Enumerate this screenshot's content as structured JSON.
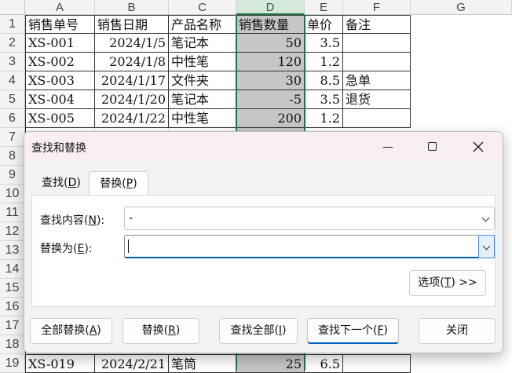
{
  "sheet": {
    "columns": [
      "A",
      "B",
      "C",
      "D",
      "E",
      "F",
      "G"
    ],
    "rows": [
      "1",
      "2",
      "3",
      "4",
      "5",
      "6",
      "7",
      "8",
      "9",
      "10",
      "11",
      "12",
      "13",
      "14",
      "15",
      "16",
      "17",
      "18",
      "19"
    ],
    "headers": [
      "销售单号",
      "销售日期",
      "产品名称",
      "销售数量",
      "单价",
      "备注"
    ],
    "data": [
      [
        "XS-001",
        "2024/1/5",
        "笔记本",
        "50",
        "3.5",
        ""
      ],
      [
        "XS-002",
        "2024/1/8",
        "中性笔",
        "120",
        "1.2",
        ""
      ],
      [
        "XS-003",
        "2024/1/17",
        "文件夹",
        "30",
        "8.5",
        "急单"
      ],
      [
        "XS-004",
        "2024/1/20",
        "笔记本",
        "-5",
        "3.5",
        "退货"
      ],
      [
        "XS-005",
        "2024/1/22",
        "中性笔",
        "200",
        "1.2",
        ""
      ]
    ],
    "last_row": [
      "XS-019",
      "2024/2/21",
      "笔筒",
      "25",
      "6.5",
      ""
    ]
  },
  "dialog": {
    "title": "查找和替换",
    "tabs": [
      {
        "label_main": "查找(",
        "key": "D",
        "label_end": ")"
      },
      {
        "label_main": "替换(",
        "key": "P",
        "label_end": ")"
      }
    ],
    "find_label": {
      "main": "查找内容(",
      "key": "N",
      "end": "):"
    },
    "find_value": "-",
    "replace_label": {
      "main": "替换为(",
      "key": "E",
      "end": "):"
    },
    "replace_value": "",
    "options_button": {
      "main": "选项(",
      "key": "T",
      "end": ") >>"
    },
    "buttons": {
      "replace_all": {
        "main": "全部替换(",
        "key": "A",
        "end": ")"
      },
      "replace": {
        "main": "替换(",
        "key": "R",
        "end": ")"
      },
      "find_all": {
        "main": "查找全部(",
        "key": "I",
        "end": ")"
      },
      "find_next": {
        "main": "查找下一个(",
        "key": "F",
        "end": ")"
      },
      "close": "关闭"
    },
    "colors": {
      "accent": "#005fb8",
      "title_bg": "#f9eef1"
    }
  }
}
